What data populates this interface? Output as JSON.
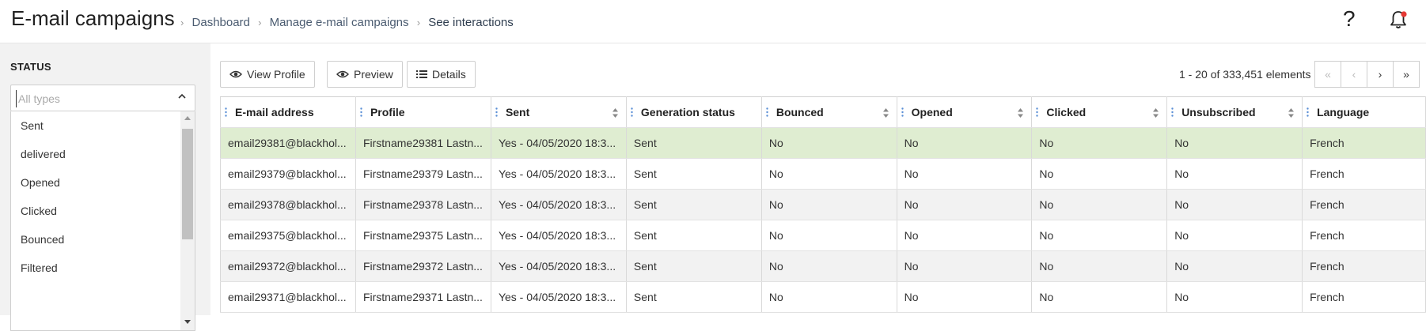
{
  "header": {
    "title": "E-mail campaigns",
    "breadcrumb": [
      "Dashboard",
      "Manage e-mail campaigns",
      "See interactions"
    ],
    "help_glyph": "?",
    "icons": {
      "help": "question-mark-icon",
      "notifications": "bell-icon"
    },
    "notification_dot_color": "#e53935"
  },
  "sidebar": {
    "status_label": "STATUS",
    "select": {
      "placeholder": "All types"
    },
    "options": [
      "Sent",
      "delivered",
      "Opened",
      "Clicked",
      "Bounced",
      "Filtered"
    ]
  },
  "toolbar": {
    "view_profile": "View Profile",
    "preview": "Preview",
    "details": "Details"
  },
  "pagination": {
    "summary": "1 - 20 of 333,451 elements",
    "first": "«",
    "prev": "‹",
    "next": "›",
    "last": "»"
  },
  "table": {
    "columns": [
      "E-mail address",
      "Profile",
      "Sent",
      "Generation status",
      "Bounced",
      "Opened",
      "Clicked",
      "Unsubscribed",
      "Language"
    ],
    "rows": [
      [
        "email29381@blackhol...",
        "Firstname29381 Lastn...",
        "Yes - 04/05/2020 18:3...",
        "Sent",
        "No",
        "No",
        "No",
        "No",
        "French"
      ],
      [
        "email29379@blackhol...",
        "Firstname29379 Lastn...",
        "Yes - 04/05/2020 18:3...",
        "Sent",
        "No",
        "No",
        "No",
        "No",
        "French"
      ],
      [
        "email29378@blackhol...",
        "Firstname29378 Lastn...",
        "Yes - 04/05/2020 18:3...",
        "Sent",
        "No",
        "No",
        "No",
        "No",
        "French"
      ],
      [
        "email29375@blackhol...",
        "Firstname29375 Lastn...",
        "Yes - 04/05/2020 18:3...",
        "Sent",
        "No",
        "No",
        "No",
        "No",
        "French"
      ],
      [
        "email29372@blackhol...",
        "Firstname29372 Lastn...",
        "Yes - 04/05/2020 18:3...",
        "Sent",
        "No",
        "No",
        "No",
        "No",
        "French"
      ],
      [
        "email29371@blackhol...",
        "Firstname29371 Lastn...",
        "Yes - 04/05/2020 18:3...",
        "Sent",
        "No",
        "No",
        "No",
        "No",
        "French"
      ]
    ],
    "selected_row_color": "#dfedd1"
  }
}
